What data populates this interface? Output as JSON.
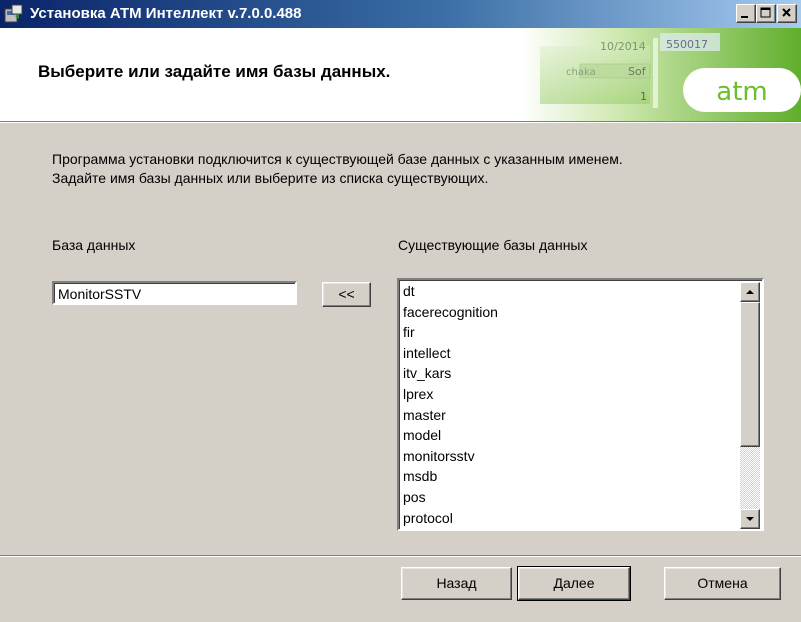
{
  "window": {
    "title": "Установка АТМ Интеллект v.7.0.0.488",
    "controls": [
      "minimize-icon",
      "maximize-icon",
      "close-icon"
    ]
  },
  "header": {
    "title": "Выберите или задайте имя базы данных.",
    "logo_text": "atm",
    "art_texts": [
      "10/2014",
      "550017",
      "chaka",
      "Sof",
      "1"
    ]
  },
  "main": {
    "description_line1": "Программа установки подключится к существующей базе данных с указанным именем.",
    "description_line2": "Задайте имя базы данных или выберите из списка существующих.",
    "db_label": "База данных",
    "db_value": "MonitorSSTV",
    "move_button": "<<",
    "existing_label": "Существующие базы данных",
    "existing_list": [
      "dt",
      "facerecognition",
      "fir",
      "intellect",
      "itv_kars",
      "lprex",
      "master",
      "model",
      "monitorsstv",
      "msdb",
      "pos",
      "protocol"
    ]
  },
  "footer": {
    "back_button": "Назад",
    "next_button": "Далее",
    "cancel_button": "Отмена"
  },
  "colors": {
    "titlebar_start": "#0a246a",
    "titlebar_end": "#a6caf0",
    "logo_green": "#6bbf2a",
    "face": "#d4d0c8"
  }
}
